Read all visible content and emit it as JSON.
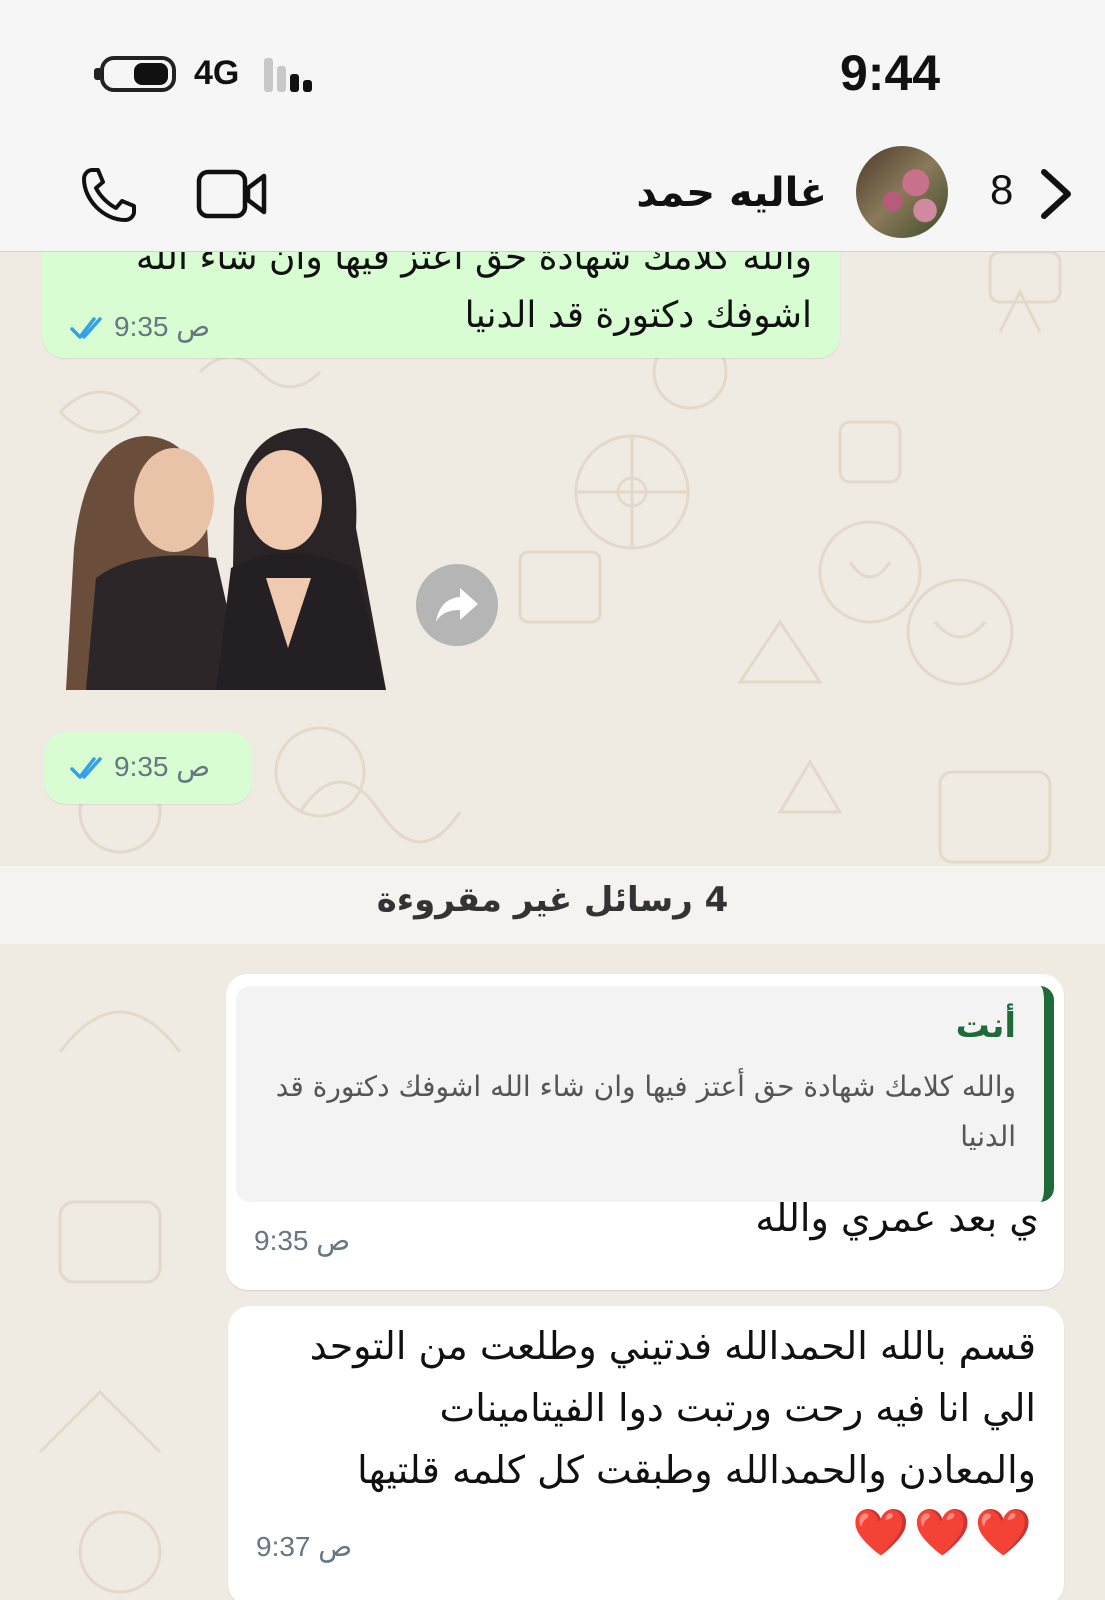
{
  "status_bar": {
    "network": "4G",
    "time": "9:44"
  },
  "header": {
    "contact_name": "غاليه حمد",
    "unread_count": "8",
    "icons": [
      "phone-icon",
      "video-camera-icon",
      "chevron-right-icon"
    ]
  },
  "messages": [
    {
      "direction": "outgoing",
      "text_line_partial": "والله كلامك شهادة حق أعتز فيها وان شاء الله",
      "text_line": "اشوفك دكتورة قد الدنيا",
      "time": "9:35 ص",
      "status": "read"
    },
    {
      "direction": "outgoing",
      "type": "sticker",
      "time": "9:35 ص",
      "status": "read"
    }
  ],
  "unread_banner": "4 رسائل غير مقروءة",
  "incoming": [
    {
      "quote_author": "أنت",
      "quote_text": "والله كلامك شهادة حق أعتز فيها وان شاء الله اشوفك دكتورة قد الدنيا",
      "text": "ي بعد عمري والله",
      "time": "9:35 ص"
    },
    {
      "lines": [
        "قسم بالله الحمدالله فدتيني وطلعت من التوحد",
        "الي انا فيه رحت ورتبت دوا الفيتامينات",
        "والمعادن والحمدالله وطبقت كل كلمه قلتيها",
        "❤️❤️❤️"
      ],
      "time": "9:37 ص"
    }
  ],
  "colors": {
    "outgoing_bubble": "#d9fdd3",
    "incoming_bubble": "#ffffff",
    "read_ticks": "#34a0e8",
    "quote_accent": "#1e6b3a",
    "chat_background": "#efeae2"
  }
}
